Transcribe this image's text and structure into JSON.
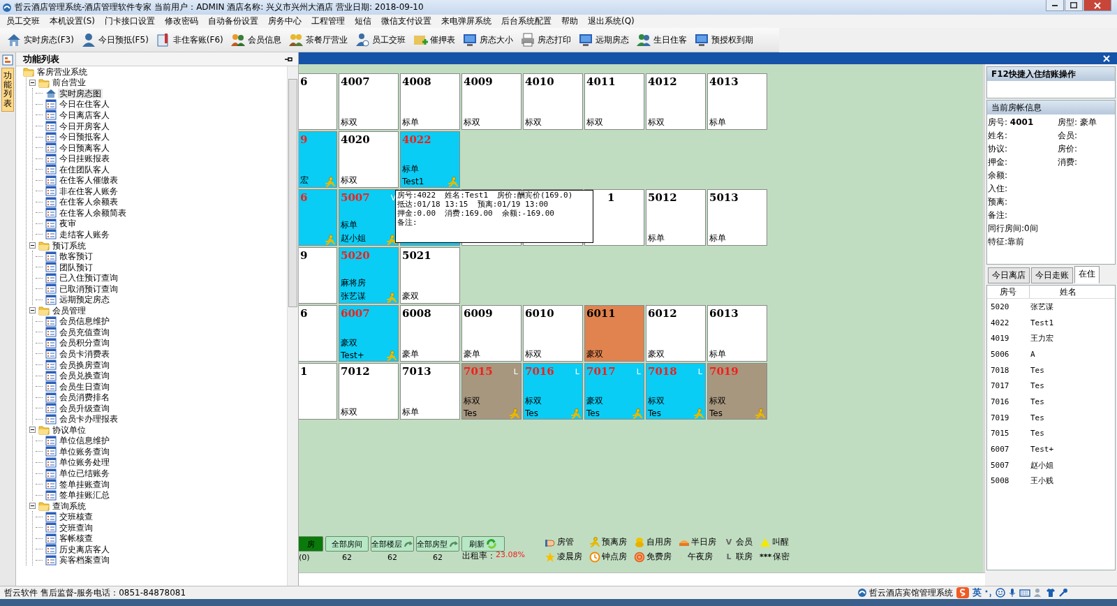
{
  "window": {
    "title": "哲云酒店管理系统-酒店管理软件专家 当前用户：ADMIN 酒店名称: 兴义市兴州大酒店 营业日期: 2018-09-10"
  },
  "menu": [
    "员工交班",
    "本机设置(S)",
    "门卡接口设置",
    "修改密码",
    "自动备份设置",
    "房务中心",
    "工程管理",
    "短信",
    "微信支付设置",
    "来电弹屏系统",
    "后台系统配置",
    "帮助",
    "退出系统(Q)"
  ],
  "toolbar": [
    "实时房态(F3)",
    "今日预抵(F5)",
    "非住客账(F6)",
    "会员信息",
    "茶餐厅营业",
    "员工交班",
    "催押表",
    "房态大小",
    "房态打印",
    "远期房态",
    "生日住客",
    "预授权到期"
  ],
  "side_tab": "功能列表",
  "tree_panel": {
    "title": "功能列表",
    "tree": [
      {
        "label": "客房营业系统",
        "children": [
          {
            "label": "前台营业",
            "expanded": true,
            "children": [
              {
                "label": "实时房态图",
                "kind": "map",
                "selected": true
              },
              {
                "label": "今日在住客人",
                "kind": "report",
                "selected": false
              },
              {
                "label": "今日离店客人",
                "kind": "report",
                "selected": false
              },
              {
                "label": "今日开房客人",
                "kind": "report",
                "selected": false
              },
              {
                "label": "今日预抵客人",
                "kind": "report",
                "selected": false
              },
              {
                "label": "今日预离客人",
                "kind": "report",
                "selected": false
              },
              {
                "label": "今日挂账报表",
                "kind": "report",
                "selected": false
              },
              {
                "label": "在住团队客人",
                "kind": "report",
                "selected": false
              },
              {
                "label": "在住客人催缴表",
                "kind": "report",
                "selected": false
              },
              {
                "label": "非在住客人账务",
                "kind": "report",
                "selected": false
              },
              {
                "label": "在住客人余额表",
                "kind": "report",
                "selected": false
              },
              {
                "label": "在住客人余额简表",
                "kind": "report",
                "selected": false
              },
              {
                "label": "夜审",
                "kind": "report",
                "selected": false
              },
              {
                "label": "走结客人账务",
                "kind": "report",
                "selected": false
              }
            ]
          },
          {
            "label": "预订系统",
            "expanded": true,
            "children": [
              {
                "label": "散客预订",
                "kind": "report",
                "selected": false
              },
              {
                "label": "团队预订",
                "kind": "report",
                "selected": false
              },
              {
                "label": "已入住预订查询",
                "kind": "report",
                "selected": false
              },
              {
                "label": "已取消预订查询",
                "kind": "report",
                "selected": false
              },
              {
                "label": "远期预定房态",
                "kind": "report",
                "selected": false
              }
            ]
          },
          {
            "label": "会员管理",
            "expanded": true,
            "children": [
              {
                "label": "会员信息维护",
                "kind": "report",
                "selected": false
              },
              {
                "label": "会员充值查询",
                "kind": "report",
                "selected": false
              },
              {
                "label": "会员积分查询",
                "kind": "report",
                "selected": false
              },
              {
                "label": "会员卡消费表",
                "kind": "report",
                "selected": false
              },
              {
                "label": "会员换房查询",
                "kind": "report",
                "selected": false
              },
              {
                "label": "会员兑换查询",
                "kind": "report",
                "selected": false
              },
              {
                "label": "会员生日查询",
                "kind": "report",
                "selected": false
              },
              {
                "label": "会员消费排名",
                "kind": "report",
                "selected": false
              },
              {
                "label": "会员升级查询",
                "kind": "report",
                "selected": false
              },
              {
                "label": "会员卡办理报表",
                "kind": "report",
                "selected": false
              }
            ]
          },
          {
            "label": "协议单位",
            "expanded": true,
            "children": [
              {
                "label": "单位信息维护",
                "kind": "report",
                "selected": false
              },
              {
                "label": "单位账务查询",
                "kind": "report",
                "selected": false
              },
              {
                "label": "单位账务处理",
                "kind": "report",
                "selected": false
              },
              {
                "label": "单位已结账务",
                "kind": "report",
                "selected": false
              },
              {
                "label": "签单挂账查询",
                "kind": "report",
                "selected": false
              },
              {
                "label": "签单挂账汇总",
                "kind": "report",
                "selected": false
              }
            ]
          },
          {
            "label": "查询系统",
            "expanded": true,
            "children": [
              {
                "label": "交班核查",
                "kind": "report",
                "selected": false
              },
              {
                "label": "交班查询",
                "kind": "report",
                "selected": false
              },
              {
                "label": "客帐核查",
                "kind": "report",
                "selected": false
              },
              {
                "label": "历史离店客人",
                "kind": "report",
                "selected": false
              },
              {
                "label": "宾客档案查询",
                "kind": "report",
                "selected": false
              }
            ]
          }
        ]
      }
    ]
  },
  "room_rows": [
    {
      "cut_cell": {
        "number": "6",
        "color": "#ffffff",
        "occupied": false
      },
      "cells": [
        {
          "number": "4007",
          "type": "标双",
          "color": "#ffffff",
          "occupied": false,
          "covered": false
        },
        {
          "number": "4008",
          "type": "标单",
          "color": "#ffffff",
          "occupied": false,
          "covered": false
        },
        {
          "number": "4009",
          "type": "标双",
          "color": "#ffffff",
          "occupied": false,
          "covered": false
        },
        {
          "number": "4010",
          "type": "标双",
          "color": "#ffffff",
          "occupied": false,
          "covered": false
        },
        {
          "number": "4011",
          "type": "标双",
          "color": "#ffffff",
          "occupied": false,
          "covered": false
        },
        {
          "number": "4012",
          "type": "标双",
          "color": "#ffffff",
          "occupied": false,
          "covered": false
        },
        {
          "number": "4013",
          "type": "标单",
          "color": "#ffffff",
          "occupied": false,
          "covered": false
        }
      ]
    },
    {
      "cut_cell": {
        "number": "9",
        "guest": "宏",
        "color": "#0acdf5",
        "occupied": true
      },
      "cells": [
        {
          "number": "4020",
          "type": "标双",
          "color": "#ffffff",
          "occupied": false,
          "covered": false
        },
        {
          "number": "4022",
          "type": "标单",
          "guest": "Test1",
          "color": "#0acdf5",
          "occupied": true,
          "covered": false
        }
      ]
    },
    {
      "cut_cell": {
        "number": "6",
        "color": "#0acdf5",
        "occupied": true
      },
      "cells": [
        {
          "number": "5007",
          "type": "标单",
          "marker": "V",
          "guest": "赵小姐",
          "color": "#0acdf5",
          "occupied": true,
          "covered": false
        },
        {
          "color": "#0acdf5"
        },
        {
          "color": "#ffffff"
        },
        {
          "color": "#ffffff"
        },
        {
          "number": "1",
          "color": "#ffffff",
          "occupied": false,
          "covered": true
        },
        {
          "number": "5012",
          "type": "标单",
          "color": "#ffffff",
          "occupied": false,
          "covered": false
        },
        {
          "number": "5013",
          "type": "标单",
          "color": "#ffffff",
          "occupied": false,
          "covered": false
        }
      ]
    },
    {
      "cut_cell": {
        "number": "9",
        "color": "#ffffff",
        "occupied": false
      },
      "cells": [
        {
          "number": "5020",
          "type": "麻将房",
          "guest": "张艺谋",
          "color": "#0acdf5",
          "occupied": true,
          "covered": false
        },
        {
          "number": "5021",
          "type": "豪双",
          "color": "#ffffff",
          "occupied": false,
          "covered": false
        }
      ]
    },
    {
      "cut_cell": {
        "number": "6",
        "color": "#ffffff",
        "occupied": false
      },
      "cells": [
        {
          "number": "6007",
          "type": "豪双",
          "guest": "Test+",
          "color": "#0acdf5",
          "occupied": true,
          "covered": false
        },
        {
          "number": "6008",
          "type": "豪单",
          "color": "#ffffff",
          "occupied": false,
          "covered": false
        },
        {
          "number": "6009",
          "type": "豪单",
          "color": "#ffffff",
          "occupied": false,
          "covered": false
        },
        {
          "number": "6010",
          "type": "标双",
          "color": "#ffffff",
          "occupied": false,
          "covered": false
        },
        {
          "number": "6011",
          "type": "豪双",
          "color": "#e0834f",
          "occupied": false,
          "covered": false
        },
        {
          "number": "6012",
          "type": "豪双",
          "color": "#ffffff",
          "occupied": false,
          "covered": false
        },
        {
          "number": "6013",
          "type": "标单",
          "color": "#ffffff",
          "occupied": false,
          "covered": false
        }
      ]
    },
    {
      "cut_cell": {
        "number": "1",
        "color": "#ffffff",
        "occupied": false
      },
      "cells": [
        {
          "number": "7012",
          "type": "标双",
          "color": "#ffffff",
          "occupied": false,
          "covered": false
        },
        {
          "number": "7013",
          "type": "标单",
          "color": "#ffffff",
          "occupied": false,
          "covered": false
        },
        {
          "number": "7015",
          "marker": "L",
          "type": "标双",
          "guest": "Tes",
          "color": "#a8977f",
          "occupied": true,
          "covered": false
        },
        {
          "number": "7016",
          "marker": "L",
          "type": "标双",
          "guest": "Tes",
          "color": "#0acdf5",
          "occupied": true,
          "covered": false
        },
        {
          "number": "7017",
          "marker": "L",
          "type": "豪双",
          "guest": "Tes",
          "color": "#0acdf5",
          "occupied": true,
          "covered": false
        },
        {
          "number": "7018",
          "marker": "L",
          "type": "标双",
          "guest": "Tes",
          "color": "#0acdf5",
          "occupied": true,
          "covered": false
        },
        {
          "number": "7019",
          "type": "标双",
          "guest": "Tes",
          "color": "#a8977f",
          "occupied": true,
          "covered": false
        }
      ]
    }
  ],
  "tooltip": {
    "lines": [
      "房号:4022  姓名:Test1  房价:酬宾价(169.0)",
      "抵达:01/18 13:15  预离:01/19 13:00",
      "押金:0.00  消费:169.00  余额:-169.00",
      "备注:"
    ]
  },
  "filter_buttons": [
    {
      "label": "房",
      "count": "(0)",
      "kind": "plain",
      "selected": true
    },
    {
      "label": "全部房间",
      "count": "62",
      "kind": "plain",
      "selected": false
    },
    {
      "label": "全部楼层",
      "count": "62",
      "kind": "arrow",
      "selected": false
    },
    {
      "label": "全部房型",
      "count": "62",
      "kind": "arrow",
      "selected": false
    },
    {
      "label": "刷新",
      "kind": "refresh",
      "selected": false
    }
  ],
  "occupancy": {
    "label": "出租率：",
    "value": "23.08%"
  },
  "legend": [
    {
      "label": "房管",
      "kind": "hand"
    },
    {
      "label": "预离房",
      "kind": "runner"
    },
    {
      "label": "自用房",
      "kind": "coin"
    },
    {
      "label": "半日房",
      "kind": "bowl"
    },
    {
      "label": "会员",
      "kind": "symbol",
      "symbol": "V"
    },
    {
      "label": "叫醒",
      "kind": "triangle"
    },
    {
      "label": "凌晨房",
      "kind": "star"
    },
    {
      "label": "钟点房",
      "kind": "clock"
    },
    {
      "label": "免费房",
      "kind": "ring"
    },
    {
      "label": "午夜房",
      "kind": "moon"
    },
    {
      "label": "联房",
      "kind": "symbol",
      "symbol": "L"
    },
    {
      "label": "保密",
      "kind": "symbol",
      "symbol": "***"
    }
  ],
  "right_panel": {
    "quick_title": "F12快捷入住结账操作",
    "info_title": "当前房帐信息",
    "info_rows": [
      [
        "房号: **4001**",
        "房型: 豪单"
      ],
      [
        "姓名:",
        "会员:"
      ],
      [
        "协议:",
        "房价:"
      ],
      [
        "押金:",
        "消费:"
      ],
      [
        "余额:"
      ],
      [
        "入住:"
      ],
      [
        "预离:"
      ],
      [
        "备注:"
      ],
      [
        "同行房间:0间"
      ],
      [
        "特征:靠前"
      ]
    ],
    "tabs": [
      {
        "label": "今日离店",
        "selected": false
      },
      {
        "label": "今日走账",
        "selected": false
      },
      {
        "label": "在住",
        "selected": true
      }
    ],
    "columns": [
      "房号",
      "姓名"
    ],
    "rows": [
      [
        "5020",
        "张艺谋"
      ],
      [
        "4022",
        "Test1"
      ],
      [
        "4019",
        "王力宏"
      ],
      [
        "5006",
        "A"
      ],
      [
        "7018",
        "Tes"
      ],
      [
        "7017",
        "Tes"
      ],
      [
        "7016",
        "Tes"
      ],
      [
        "7019",
        "Tes"
      ],
      [
        "7015",
        "Tes"
      ],
      [
        "6007",
        "Test+"
      ],
      [
        "5007",
        "赵小姐"
      ],
      [
        "5008",
        "王小贱"
      ]
    ]
  },
  "status_bar": {
    "text": "哲云软件 售后监督-服务电话：0851-84878081",
    "task": "哲云酒店宾馆管理系统",
    "ime": "英"
  }
}
